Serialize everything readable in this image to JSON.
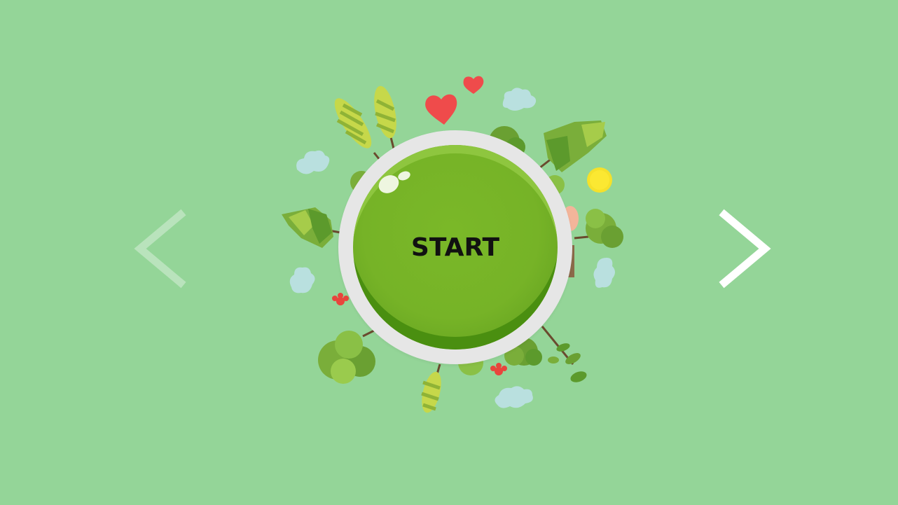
{
  "screen": {
    "background_color": "#94d598",
    "accent_color": "#76b327"
  },
  "start_button": {
    "label": "START"
  },
  "navigation": {
    "prev_icon": "chevron-left-icon",
    "next_icon": "chevron-right-icon",
    "prev_enabled": false,
    "next_enabled": true
  },
  "decorations": [
    "tree-icon",
    "heart-icon",
    "cloud-icon",
    "sun-icon",
    "flower-icon",
    "bush-icon"
  ]
}
